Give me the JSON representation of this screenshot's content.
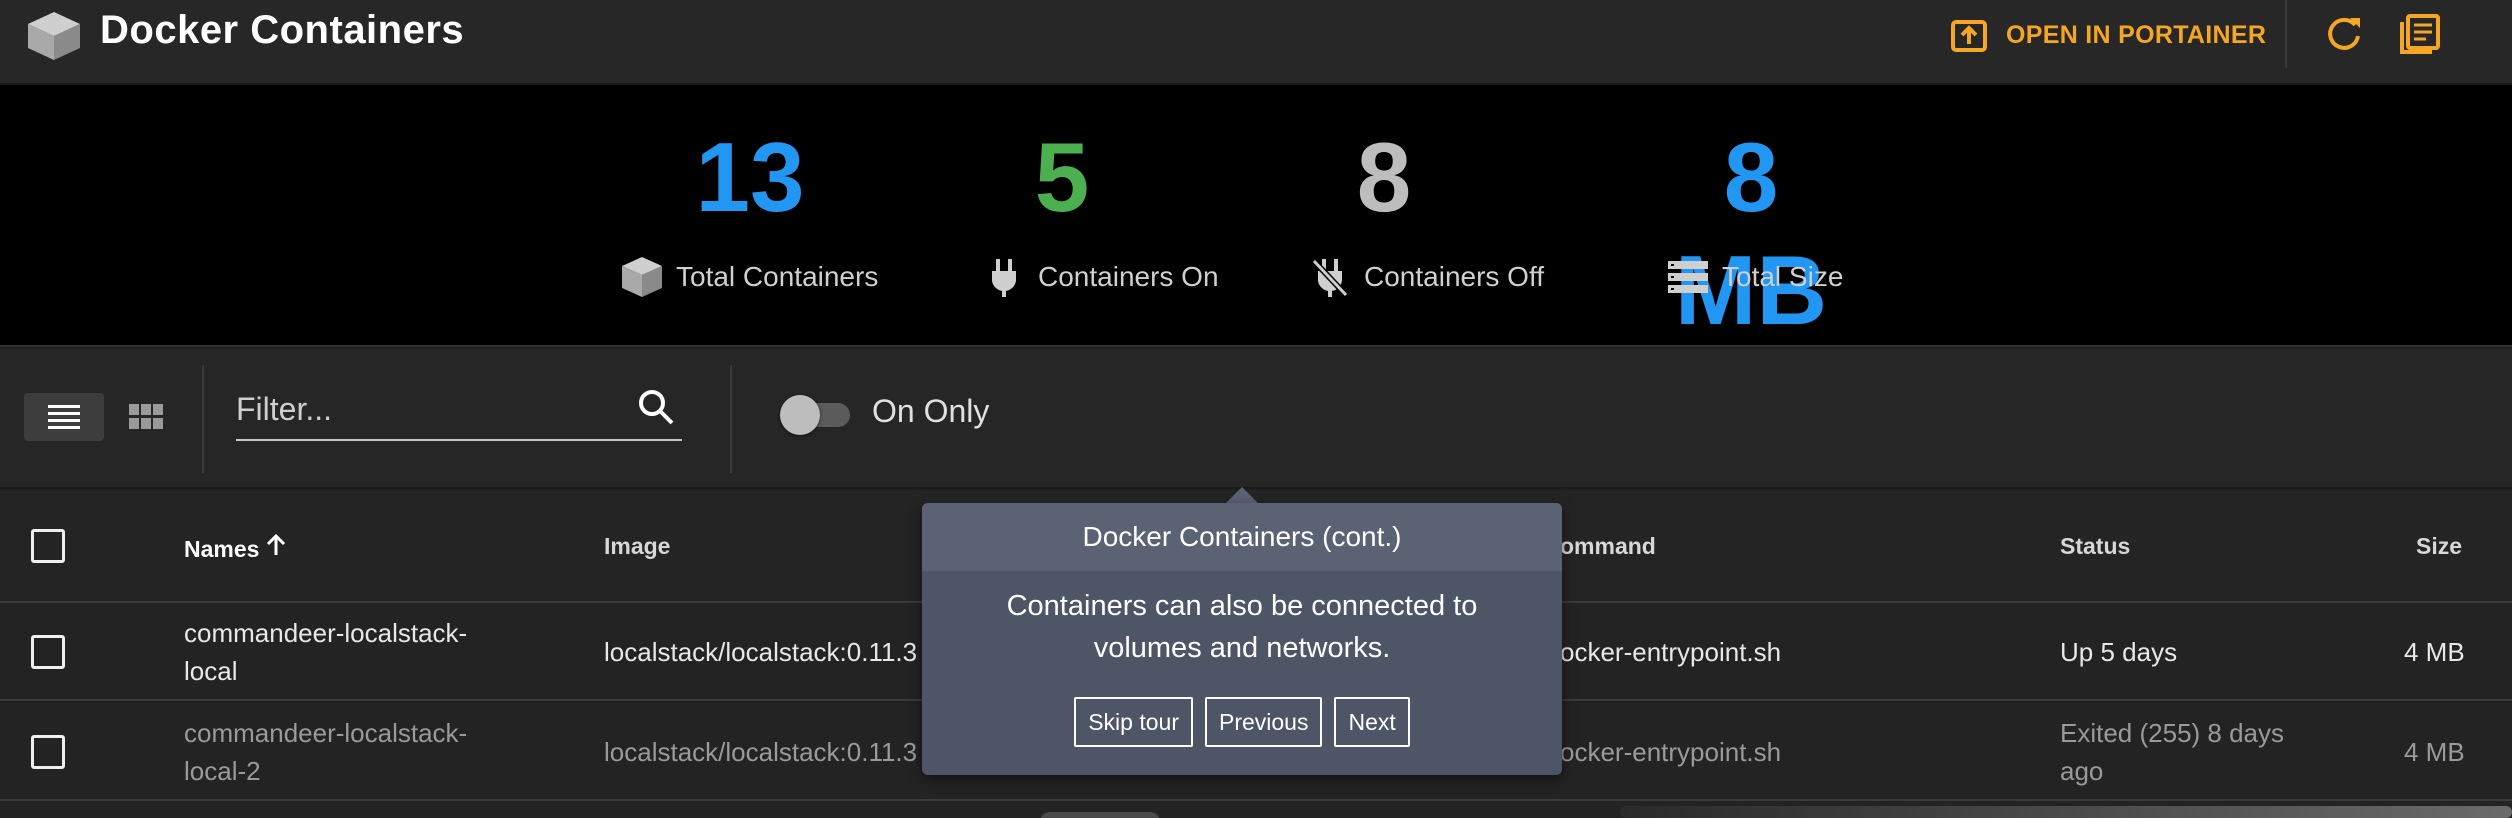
{
  "header": {
    "title": "Docker Containers",
    "portainer_label": "OPEN IN PORTAINER",
    "accent_color": "#f5a623"
  },
  "stats": [
    {
      "value": "13",
      "label": "Total Containers",
      "color": "#2196f3",
      "icon": "cube-icon"
    },
    {
      "value": "5",
      "label": "Containers On",
      "color": "#4caf50",
      "icon": "plug-icon"
    },
    {
      "value": "8",
      "label": "Containers Off",
      "color": "#bdbdbd",
      "icon": "plug-off-icon"
    },
    {
      "value": "8 MB",
      "label": "Total Size",
      "color": "#2196f3",
      "icon": "storage-icon"
    }
  ],
  "toolbar": {
    "filter_placeholder": "Filter...",
    "on_only_label": "On Only",
    "on_only_checked": false
  },
  "table": {
    "columns": {
      "names": "Names",
      "image": "Image",
      "command": "ommand",
      "status": "Status",
      "size": "Size"
    },
    "rows": [
      {
        "name_line1": "commandeer-localstack-",
        "name_line2": "local",
        "image": "localstack/localstack:0.11.3",
        "command": "ocker-entrypoint.sh",
        "status_line1": "Up 5 days",
        "status_line2": "",
        "size": "4 MB"
      },
      {
        "name_line1": "commandeer-localstack-",
        "name_line2": "local-2",
        "image": "localstack/localstack:0.11.3",
        "command": "ocker-entrypoint.sh",
        "status_line1": "Exited (255) 8 days",
        "status_line2": "ago",
        "size": "4 MB"
      }
    ]
  },
  "tour": {
    "title": "Docker Containers (cont.)",
    "body": "Containers can also be connected to volumes and networks.",
    "skip_label": "Skip tour",
    "previous_label": "Previous",
    "next_label": "Next"
  }
}
